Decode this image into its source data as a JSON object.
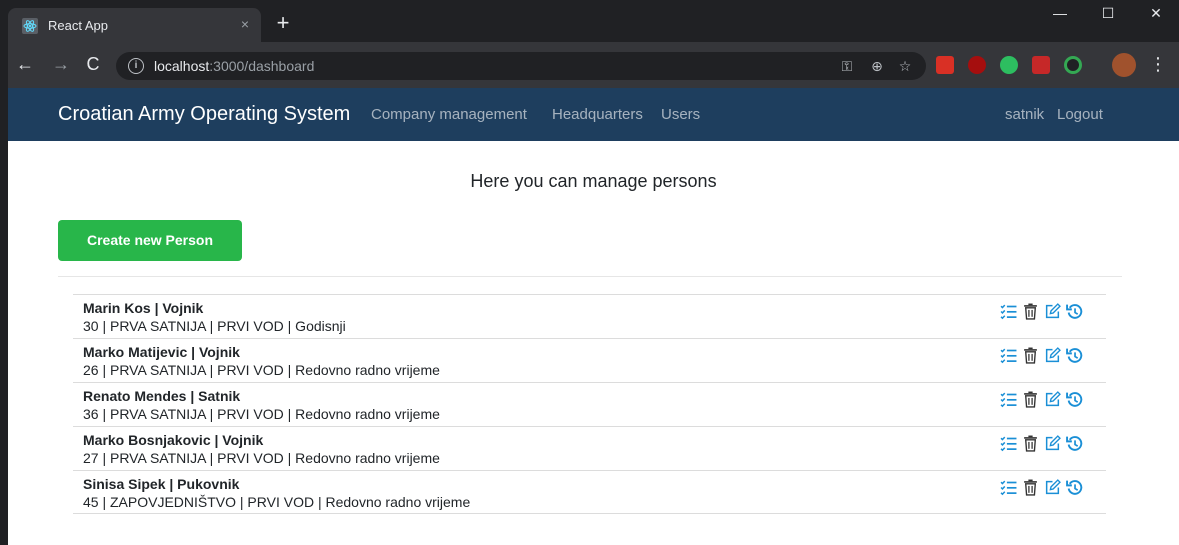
{
  "browser": {
    "tab_title": "React App",
    "tab_close": "×",
    "new_tab": "+",
    "url_host": "localhost",
    "url_path": ":3000/dashboard",
    "win_min": "—",
    "win_max": "☐",
    "win_close": "✕"
  },
  "navbar": {
    "brand": "Croatian Army Operating System",
    "links": [
      "Company management",
      "Headquarters",
      "Users"
    ],
    "user": "satnik",
    "logout": "Logout",
    "color": "#1e3e5e"
  },
  "page": {
    "heading": "Here you can manage persons",
    "create_button": "Create new Person",
    "button_color": "#28b64a",
    "icon_color": "#1a8fd6"
  },
  "persons": [
    {
      "name": "Marin Kos | Vojnik",
      "info": "30 | PRVA SATNIJA | PRVI VOD | Godisnji"
    },
    {
      "name": "Marko Matijevic | Vojnik",
      "info": "26 | PRVA SATNIJA | PRVI VOD | Redovno radno vrijeme"
    },
    {
      "name": "Renato Mendes | Satnik",
      "info": "36 | PRVA SATNIJA | PRVI VOD | Redovno radno vrijeme"
    },
    {
      "name": "Marko Bosnjakovic | Vojnik",
      "info": "27 | PRVA SATNIJA | PRVI VOD | Redovno radno vrijeme"
    },
    {
      "name": "Sinisa Sipek | Pukovnik",
      "info": "45 | ZAPOVJEDNIŠTVO | PRVI VOD | Redovno radno vrijeme"
    }
  ]
}
